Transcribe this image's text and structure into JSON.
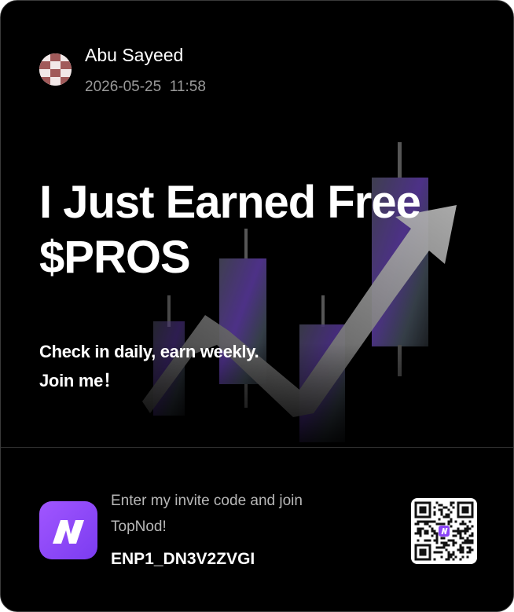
{
  "user": {
    "name": "Abu Sayeed",
    "date": "2026-05-25",
    "time": "11:58"
  },
  "headline": {
    "line1": "I Just Earned Free",
    "line2": "$PROS"
  },
  "tagline": {
    "line1": "Check in daily, earn weekly.",
    "line2": "Join me！"
  },
  "invite": {
    "prompt_line1": "Enter my invite code and join",
    "prompt_line2": "TopNod!",
    "code": "ENP1_DN3V2ZVGI"
  },
  "colors": {
    "background": "#000000",
    "brand_purple": "#8b45f7",
    "text_primary": "#ffffff",
    "text_secondary": "#9a9a9a"
  },
  "icons": {
    "avatar": "checkered-avatar",
    "app_logo": "topnod-logo",
    "qr": "qr-code"
  }
}
